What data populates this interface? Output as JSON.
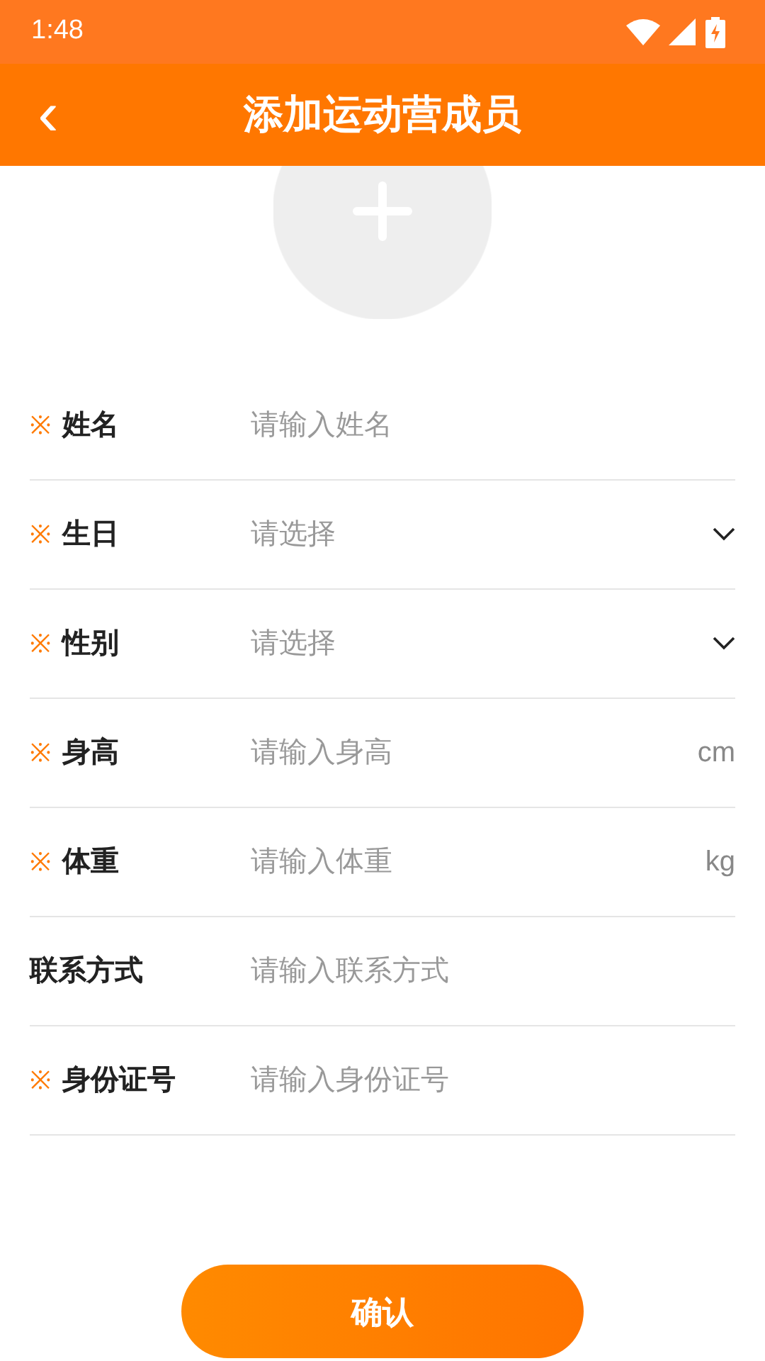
{
  "status_bar": {
    "time": "1:48"
  },
  "header": {
    "back": "‹",
    "title": "添加运动营成员"
  },
  "fields": [
    {
      "kind": "text",
      "required_mark": "※",
      "label": "姓名",
      "placeholder": "请输入姓名"
    },
    {
      "kind": "select",
      "required_mark": "※",
      "label": "生日",
      "placeholder": "请选择"
    },
    {
      "kind": "select",
      "required_mark": "※",
      "label": "性别",
      "placeholder": "请选择"
    },
    {
      "kind": "unit",
      "required_mark": "※",
      "label": "身高",
      "placeholder": "请输入身高",
      "unit": "cm"
    },
    {
      "kind": "unit",
      "required_mark": "※",
      "label": "体重",
      "placeholder": "请输入体重",
      "unit": "kg"
    },
    {
      "kind": "text",
      "label": "联系方式",
      "placeholder": "请输入联系方式"
    },
    {
      "kind": "text",
      "required_mark": "※",
      "label": "身份证号",
      "placeholder": "请输入身份证号"
    }
  ],
  "confirm_button": "确认"
}
